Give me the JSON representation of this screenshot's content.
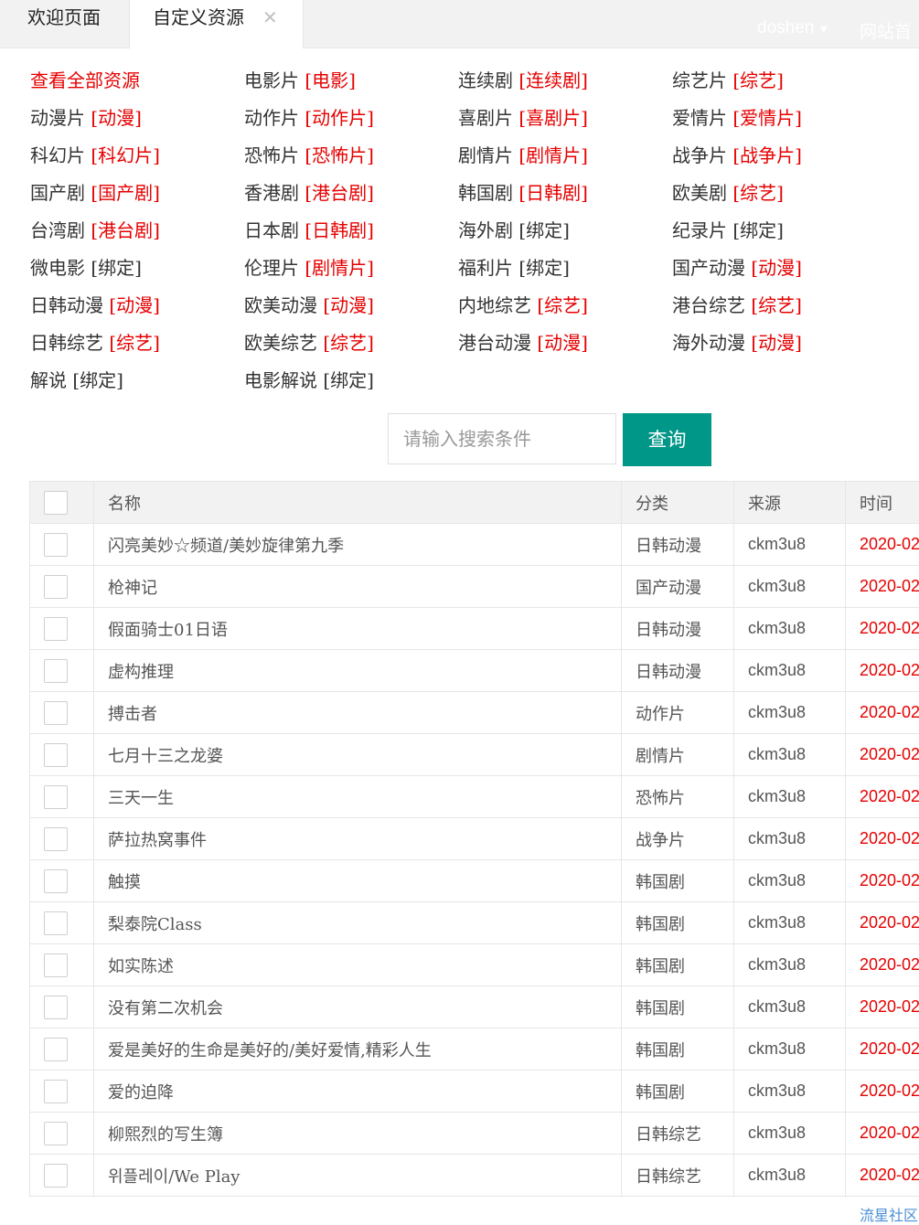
{
  "tabs": {
    "welcome": "欢迎页面",
    "custom": "自定义资源",
    "close": "✕"
  },
  "header": {
    "user": "doshen",
    "caret": "▼",
    "home": "网站首"
  },
  "categories": [
    {
      "name": "查看全部资源",
      "bind": "",
      "red": false,
      "all": true
    },
    {
      "name": "电影片",
      "bind": "[电影]",
      "red": true
    },
    {
      "name": "连续剧",
      "bind": "[连续剧]",
      "red": true
    },
    {
      "name": "综艺片",
      "bind": "[综艺]",
      "red": true
    },
    {
      "name": "动漫片",
      "bind": "[动漫]",
      "red": true
    },
    {
      "name": "动作片",
      "bind": "[动作片]",
      "red": true
    },
    {
      "name": "喜剧片",
      "bind": "[喜剧片]",
      "red": true
    },
    {
      "name": "爱情片",
      "bind": "[爱情片]",
      "red": true
    },
    {
      "name": "科幻片",
      "bind": "[科幻片]",
      "red": true
    },
    {
      "name": "恐怖片",
      "bind": "[恐怖片]",
      "red": true
    },
    {
      "name": "剧情片",
      "bind": "[剧情片]",
      "red": true
    },
    {
      "name": "战争片",
      "bind": "[战争片]",
      "red": true
    },
    {
      "name": "国产剧",
      "bind": "[国产剧]",
      "red": true
    },
    {
      "name": "香港剧",
      "bind": "[港台剧]",
      "red": true
    },
    {
      "name": "韩国剧",
      "bind": "[日韩剧]",
      "red": true
    },
    {
      "name": "欧美剧",
      "bind": "[综艺]",
      "red": true
    },
    {
      "name": "台湾剧",
      "bind": "[港台剧]",
      "red": true
    },
    {
      "name": "日本剧",
      "bind": "[日韩剧]",
      "red": true
    },
    {
      "name": "海外剧",
      "bind": "[绑定]",
      "red": false
    },
    {
      "name": "纪录片",
      "bind": "[绑定]",
      "red": false
    },
    {
      "name": "微电影",
      "bind": "[绑定]",
      "red": false
    },
    {
      "name": "伦理片",
      "bind": "[剧情片]",
      "red": true
    },
    {
      "name": "福利片",
      "bind": "[绑定]",
      "red": false
    },
    {
      "name": "国产动漫",
      "bind": "[动漫]",
      "red": true
    },
    {
      "name": "日韩动漫",
      "bind": "[动漫]",
      "red": true
    },
    {
      "name": "欧美动漫",
      "bind": "[动漫]",
      "red": true
    },
    {
      "name": "内地综艺",
      "bind": "[综艺]",
      "red": true
    },
    {
      "name": "港台综艺",
      "bind": "[综艺]",
      "red": true
    },
    {
      "name": "日韩综艺",
      "bind": "[综艺]",
      "red": true
    },
    {
      "name": "欧美综艺",
      "bind": "[综艺]",
      "red": true
    },
    {
      "name": "港台动漫",
      "bind": "[动漫]",
      "red": true
    },
    {
      "name": "海外动漫",
      "bind": "[动漫]",
      "red": true
    },
    {
      "name": "解说",
      "bind": "[绑定]",
      "red": false
    },
    {
      "name": "电影解说",
      "bind": "[绑定]",
      "red": false
    }
  ],
  "search": {
    "placeholder": "请输入搜索条件",
    "value": "",
    "button": "查询"
  },
  "table": {
    "headers": {
      "name": "名称",
      "category": "分类",
      "source": "来源",
      "time": "时间"
    },
    "rows": [
      {
        "name": "闪亮美妙☆频道/美妙旋律第九季",
        "category": "日韩动漫",
        "source": "ckm3u8",
        "time": "2020-02"
      },
      {
        "name": "枪神记",
        "category": "国产动漫",
        "source": "ckm3u8",
        "time": "2020-02"
      },
      {
        "name": "假面骑士01日语",
        "category": "日韩动漫",
        "source": "ckm3u8",
        "time": "2020-02"
      },
      {
        "name": "虚构推理",
        "category": "日韩动漫",
        "source": "ckm3u8",
        "time": "2020-02"
      },
      {
        "name": "搏击者",
        "category": "动作片",
        "source": "ckm3u8",
        "time": "2020-02"
      },
      {
        "name": "七月十三之龙婆",
        "category": "剧情片",
        "source": "ckm3u8",
        "time": "2020-02"
      },
      {
        "name": "三天一生",
        "category": "恐怖片",
        "source": "ckm3u8",
        "time": "2020-02"
      },
      {
        "name": "萨拉热窝事件",
        "category": "战争片",
        "source": "ckm3u8",
        "time": "2020-02"
      },
      {
        "name": "触摸",
        "category": "韩国剧",
        "source": "ckm3u8",
        "time": "2020-02"
      },
      {
        "name": "梨泰院Class",
        "category": "韩国剧",
        "source": "ckm3u8",
        "time": "2020-02"
      },
      {
        "name": "如实陈述",
        "category": "韩国剧",
        "source": "ckm3u8",
        "time": "2020-02"
      },
      {
        "name": "没有第二次机会",
        "category": "韩国剧",
        "source": "ckm3u8",
        "time": "2020-02"
      },
      {
        "name": "爱是美好的生命是美好的/美好爱情,精彩人生",
        "category": "韩国剧",
        "source": "ckm3u8",
        "time": "2020-02"
      },
      {
        "name": "爱的迫降",
        "category": "韩国剧",
        "source": "ckm3u8",
        "time": "2020-02"
      },
      {
        "name": "柳熙烈的写生簿",
        "category": "日韩综艺",
        "source": "ckm3u8",
        "time": "2020-02"
      },
      {
        "name": "위플레이/We Play",
        "category": "日韩综艺",
        "source": "ckm3u8",
        "time": "2020-02"
      }
    ]
  },
  "watermark": "流星社区",
  "colors": {
    "accent": "#009688",
    "red": "#e60000",
    "header_bg": "#f2f2f2"
  }
}
